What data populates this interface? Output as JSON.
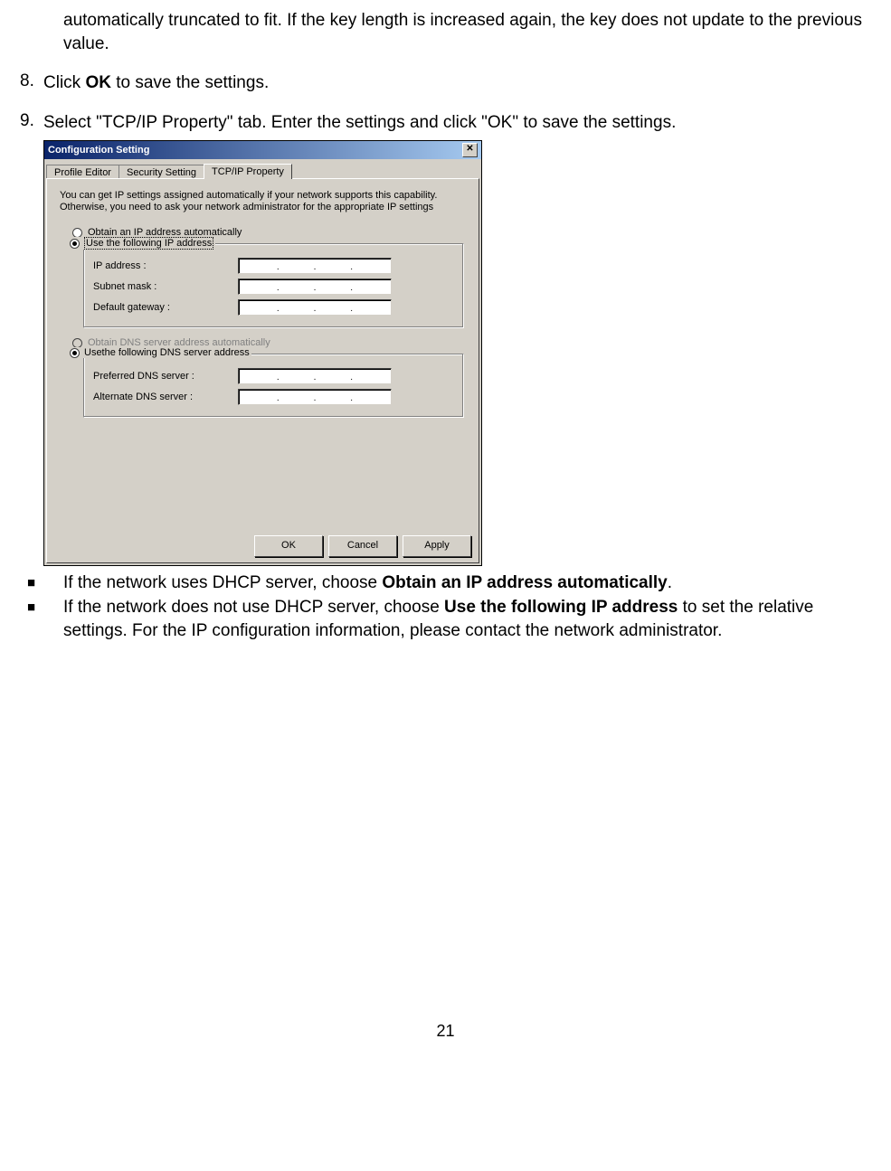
{
  "doc": {
    "cont": "automatically truncated to fit. If the key length is increased again, the key does not update to the previous value.",
    "step8_num": "8.",
    "step8_a": "Click ",
    "step8_b": "OK",
    "step8_c": " to save the settings.",
    "step9_num": "9.",
    "step9": "Select \"TCP/IP Property\" tab.  Enter the settings and click \"OK\" to save the settings.",
    "b1_a": "If the network uses DHCP server, choose ",
    "b1_b": "Obtain an IP address automatically",
    "b1_c": ".",
    "b2_a": "If the network does not use DHCP server, choose ",
    "b2_b": "Use the following IP address",
    "b2_c": " to set the relative settings.  For the IP configuration information, please contact the network administrator.",
    "page": "21",
    "bullet": "■"
  },
  "win": {
    "title": "Configuration Setting",
    "tabs": {
      "t1": "Profile Editor",
      "t2": "Security Setting",
      "t3": "TCP/IP Property"
    },
    "intro": "You can get IP settings assigned automatically if your network supports this capability. Otherwise, you need to ask your network administrator for the appropriate IP settings",
    "r1": "Obtain an IP address automatically",
    "r2": "Use the following IP address",
    "f_ip": "IP address :",
    "f_mask": "Subnet mask :",
    "f_gw": "Default gateway :",
    "r3": "Obtain DNS server address automatically",
    "r4": "Usethe following DNS server address",
    "f_dns1": "Preferred DNS server :",
    "f_dns2": "Alternate DNS server :",
    "ok": "OK",
    "cancel": "Cancel",
    "apply": "Apply"
  }
}
